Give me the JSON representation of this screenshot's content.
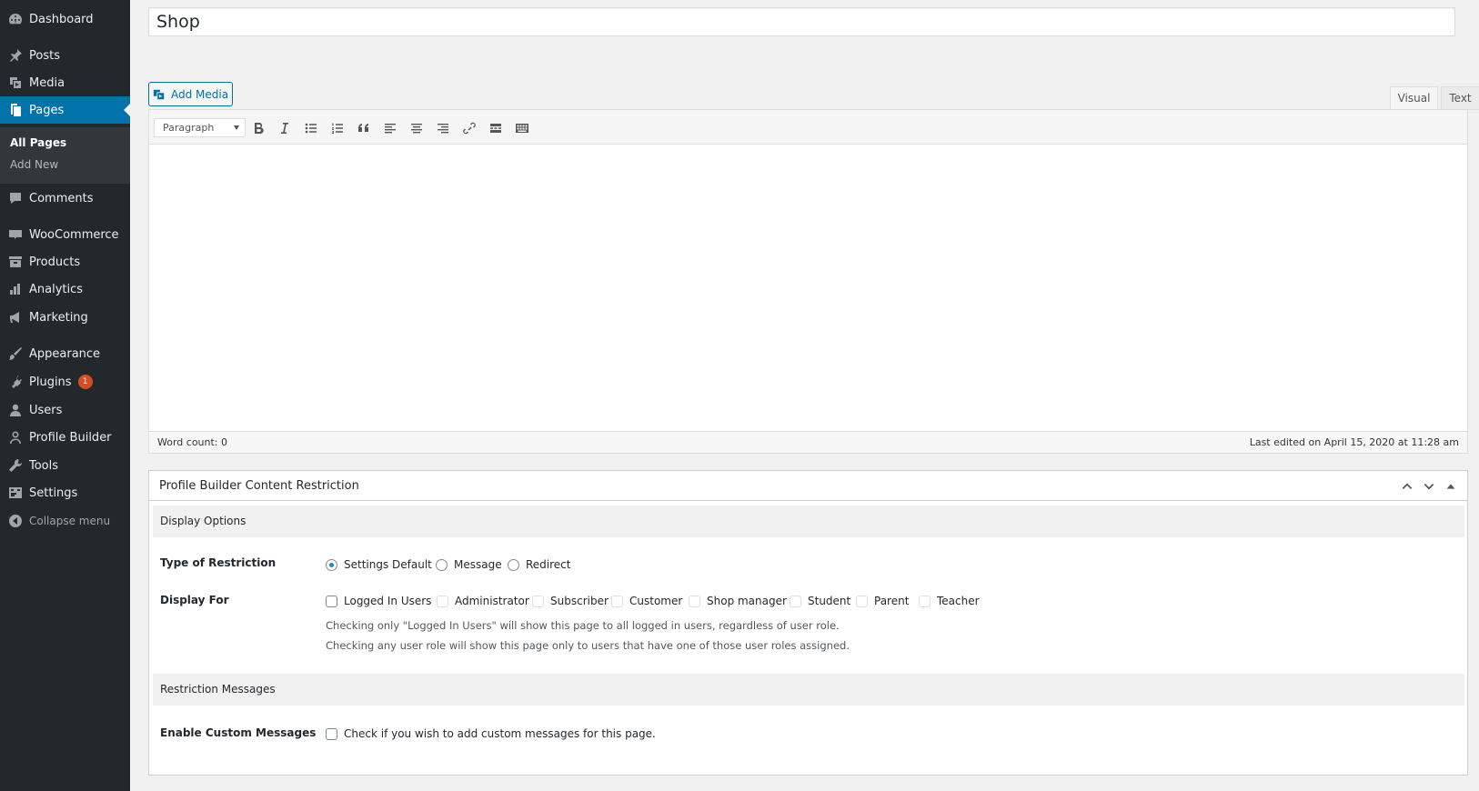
{
  "sidebar": {
    "items": [
      {
        "label": "Dashboard",
        "icon": "dashboard-icon"
      },
      {
        "label": "Posts",
        "icon": "pin-icon"
      },
      {
        "label": "Media",
        "icon": "media-icon"
      },
      {
        "label": "Pages",
        "icon": "pages-icon"
      },
      {
        "label": "Comments",
        "icon": "comments-icon"
      },
      {
        "label": "WooCommerce",
        "icon": "woocommerce-icon"
      },
      {
        "label": "Products",
        "icon": "archive-icon"
      },
      {
        "label": "Analytics",
        "icon": "bar-chart-icon"
      },
      {
        "label": "Marketing",
        "icon": "megaphone-icon"
      },
      {
        "label": "Appearance",
        "icon": "brush-icon"
      },
      {
        "label": "Plugins",
        "icon": "plug-icon"
      },
      {
        "label": "Users",
        "icon": "user-icon"
      },
      {
        "label": "Profile Builder",
        "icon": "user-outline-icon"
      },
      {
        "label": "Tools",
        "icon": "wrench-icon"
      },
      {
        "label": "Settings",
        "icon": "settings-icon"
      },
      {
        "label": "Collapse menu",
        "icon": "collapse-icon"
      }
    ],
    "submenu": {
      "all_pages": "All Pages",
      "add_new": "Add New"
    },
    "plugins_badge": "1",
    "active_color": "#0073aa",
    "sidebar_color": "#23282d"
  },
  "post": {
    "title": "Shop"
  },
  "editor": {
    "add_media": "Add Media",
    "tabs": {
      "visual": "Visual",
      "text": "Text"
    },
    "format_select": "Paragraph",
    "toolbar_buttons": [
      "bold-icon",
      "italic-icon",
      "bulleted-list-icon",
      "numbered-list-icon",
      "blockquote-icon",
      "align-left-icon",
      "align-center-icon",
      "align-right-icon",
      "link-icon",
      "read-more-icon",
      "toolbar-toggle-icon"
    ],
    "word_count": "Word count: 0",
    "last_edited": "Last edited on April 15, 2020 at 11:28 am"
  },
  "metabox": {
    "title": "Profile Builder Content Restriction",
    "display_options": "Display Options",
    "type_of_restriction": {
      "label": "Type of Restriction",
      "options": [
        "Settings Default",
        "Message",
        "Redirect"
      ],
      "selected": "Settings Default"
    },
    "display_for": {
      "label": "Display For",
      "options": [
        "Logged In Users",
        "Administrator",
        "Subscriber",
        "Customer",
        "Shop manager",
        "Student",
        "Parent",
        "Teacher"
      ],
      "desc1": "Checking only \"Logged In Users\" will show this page to all logged in users, regardless of user role.",
      "desc2": "Checking any user role will show this page only to users that have one of those user roles assigned."
    },
    "restriction_messages": "Restriction Messages",
    "enable_custom_messages": {
      "label": "Enable Custom Messages",
      "checkbox": "Check if you wish to add custom messages for this page."
    }
  }
}
